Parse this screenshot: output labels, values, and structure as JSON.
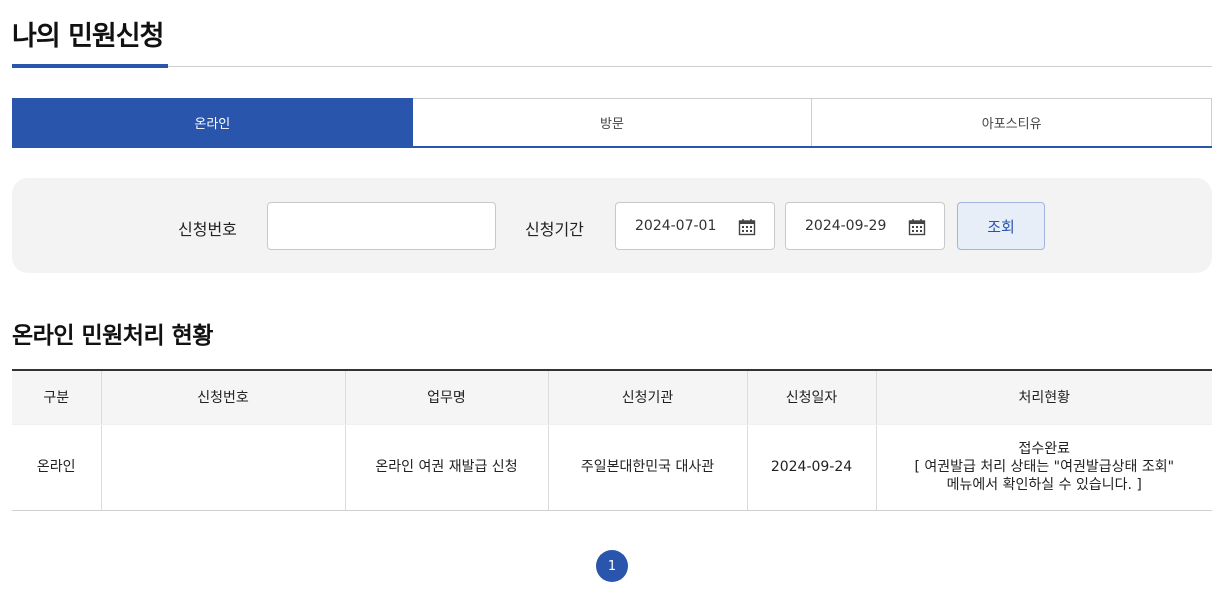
{
  "page_title": "나의 민원신청",
  "tabs": [
    {
      "label": "온라인",
      "active": true
    },
    {
      "label": "방문",
      "active": false
    },
    {
      "label": "아포스티유",
      "active": false
    }
  ],
  "search": {
    "number_label": "신청번호",
    "number_value": "",
    "period_label": "신청기간",
    "date_from": "2024-07-01",
    "date_to": "2024-09-29",
    "button_label": "조회"
  },
  "section_title": "온라인 민원처리 현황",
  "table": {
    "headers": [
      "구분",
      "신청번호",
      "업무명",
      "신청기관",
      "신청일자",
      "처리현황"
    ],
    "rows": [
      {
        "type": "온라인",
        "number": "",
        "service": "온라인 여권 재발급 신청",
        "agency": "주일본대한민국 대사관",
        "date": "2024-09-24",
        "status_line1": "접수완료",
        "status_line2": "[ 여권발급 처리 상태는 \"여권발급상태 조회\"",
        "status_line3": "메뉴에서 확인하실 수 있습니다. ]"
      }
    ]
  },
  "pagination": {
    "current": "1"
  },
  "colors": {
    "accent": "#2a55ad",
    "search_bg": "#f3f3f3"
  }
}
